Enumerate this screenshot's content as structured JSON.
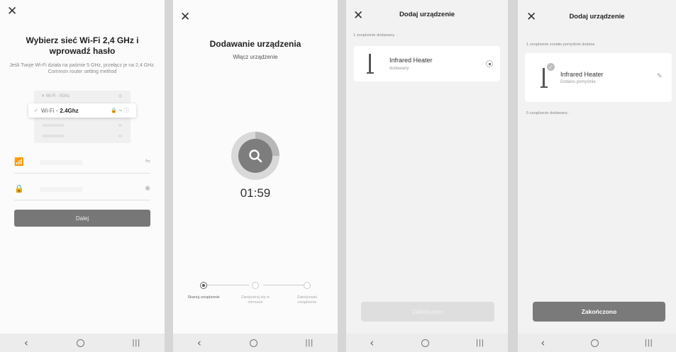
{
  "icons": {
    "close": "✕",
    "back": "‹",
    "recent": "|||",
    "wifi": "📶",
    "lock": "🔒",
    "swap": "⇋",
    "eye": "◉",
    "check": "✓",
    "edit": "✎"
  },
  "screen1": {
    "title": "Wybierz sieć Wi-Fi 2,4 GHz i wprowadź hasło",
    "subtitle": "Jeśli Twoje Wi-Fi działa na paśmie 5 GHz, przełącz je na 2,4 GHz. Common router setting method",
    "illustration": {
      "row5_prefix": "✕ Wi-Fi -",
      "row5_band": "5Ghz",
      "row24_prefix": "Wi-Fi -",
      "row24_band": "2.4Ghz",
      "row24_icons": "🔒 ≈ ⓘ"
    },
    "next_label": "Dalej"
  },
  "screen2": {
    "title": "Dodawanie urządzenia",
    "subtitle": "Włącz urządzenie",
    "timer": "01:59",
    "steps": [
      {
        "label": "Skanuj urządzenie",
        "active": true
      },
      {
        "label": "Zarejestruj się w chmurze",
        "active": false
      },
      {
        "label": "Zainicjować urządzenie",
        "active": false
      }
    ]
  },
  "screen3": {
    "title": "Dodaj urządzenie",
    "section_label": "1 urządzenie dodawany",
    "device_name": "Infrared Heater",
    "device_status": "dodawany",
    "done_label": "Zakończono"
  },
  "screen4": {
    "title": "Dodaj urządzenie",
    "section_label": "1 urządzenie zostało pomyślnie dodane",
    "device_name": "Infrared Heater",
    "device_status": "Dodano pomyślnie",
    "pending_label": "0 urządzenie dodawany",
    "done_label": "Zakończono"
  }
}
